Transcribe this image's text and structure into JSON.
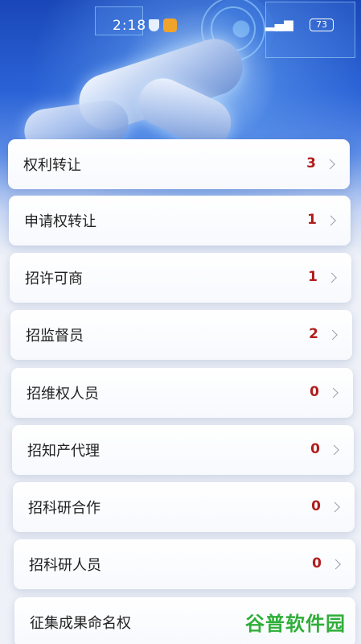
{
  "status_bar": {
    "time": "2:18",
    "battery": "73",
    "icons": [
      "shield-icon",
      "app-icon",
      "signal-icon",
      "wifi-icon",
      "battery-icon"
    ]
  },
  "hero": {
    "image": "robot-hand-illustration"
  },
  "items": [
    {
      "label": "权利转让",
      "count": "3"
    },
    {
      "label": "申请权转让",
      "count": "1"
    },
    {
      "label": "招许可商",
      "count": "1"
    },
    {
      "label": "招监督员",
      "count": "2"
    },
    {
      "label": "招维权人员",
      "count": "0"
    },
    {
      "label": "招知产代理",
      "count": "0"
    },
    {
      "label": "招科研合作",
      "count": "0"
    },
    {
      "label": "招科研人员",
      "count": "0"
    },
    {
      "label": "征集成果命名权",
      "count": ""
    }
  ],
  "watermark": "谷普软件园",
  "colors": {
    "count": "#b01d1d",
    "accent_blue": "#2a62d6",
    "watermark": "#2fae3a"
  }
}
